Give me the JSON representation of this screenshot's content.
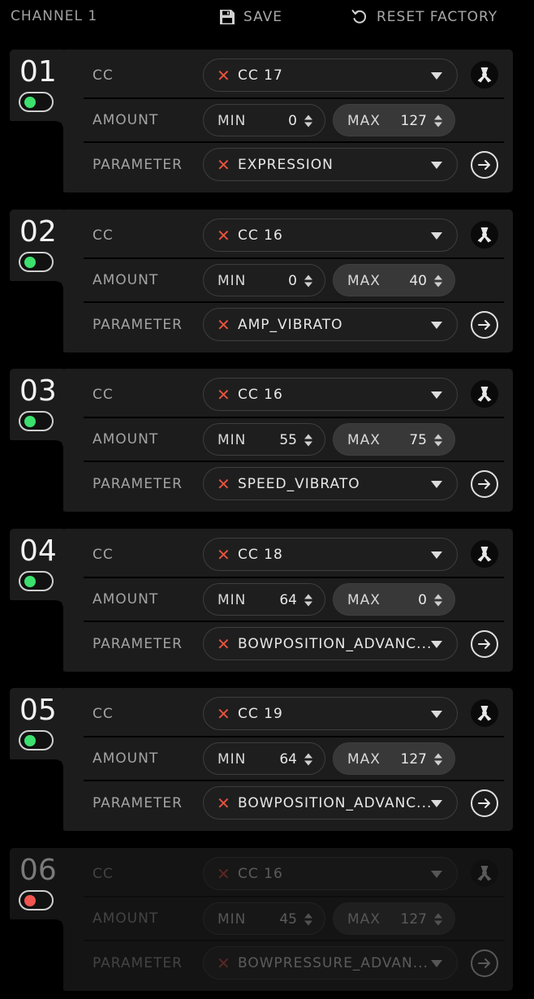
{
  "header": {
    "channel_title": "CHANNEL 1",
    "save_label": "SAVE",
    "reset_label": "RESET FACTORY"
  },
  "row_labels": {
    "cc": "CC",
    "amount": "AMOUNT",
    "parameter": "PARAMETER",
    "min": "MIN",
    "max": "MAX"
  },
  "colors": {
    "toggle_on": "#3de06e",
    "toggle_off": "#f0554f",
    "remove_x": "#e5533f"
  },
  "mappings": [
    {
      "number": "01",
      "enabled": true,
      "cc": "CC 17",
      "min": "0",
      "max": "127",
      "parameter": "EXPRESSION"
    },
    {
      "number": "02",
      "enabled": true,
      "cc": "CC 16",
      "min": "0",
      "max": "40",
      "parameter": "AMP_VIBRATO"
    },
    {
      "number": "03",
      "enabled": true,
      "cc": "CC 16",
      "min": "55",
      "max": "75",
      "parameter": "SPEED_VIBRATO"
    },
    {
      "number": "04",
      "enabled": true,
      "cc": "CC 18",
      "min": "64",
      "max": "0",
      "parameter": "BOWPOSITION_ADVANC..."
    },
    {
      "number": "05",
      "enabled": true,
      "cc": "CC 19",
      "min": "64",
      "max": "127",
      "parameter": "BOWPOSITION_ADVANC..."
    },
    {
      "number": "06",
      "enabled": false,
      "cc": "CC 16",
      "min": "45",
      "max": "127",
      "parameter": "BOWPRESSURE_ADVAN..."
    }
  ]
}
